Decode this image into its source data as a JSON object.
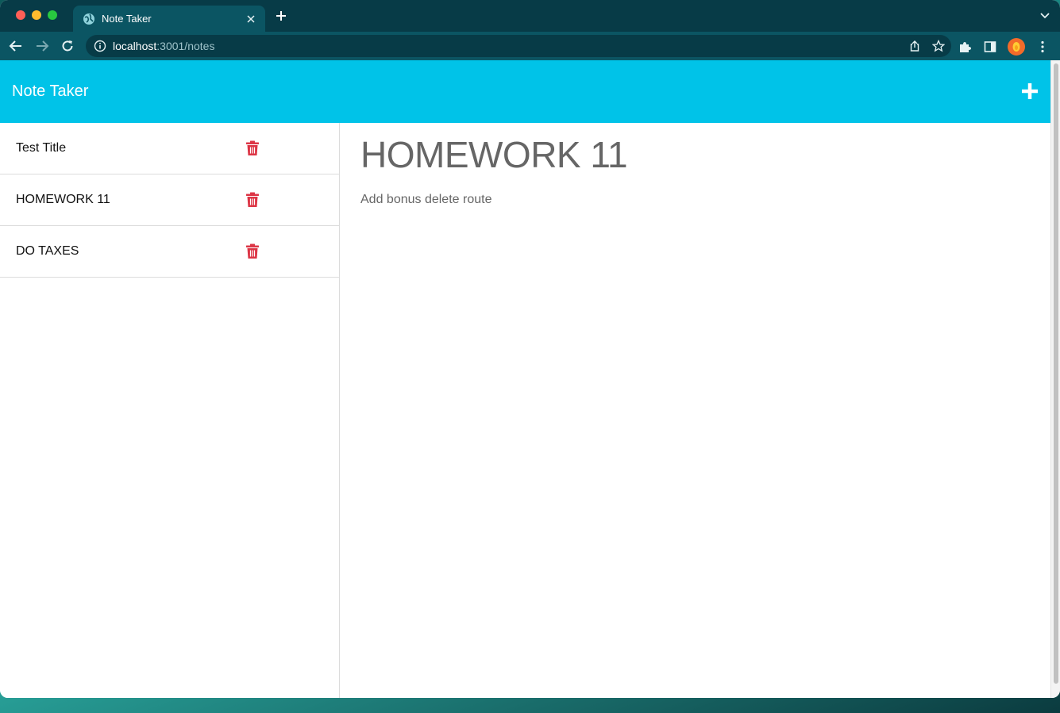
{
  "browser": {
    "tab_title": "Note Taker",
    "url_host": "localhost",
    "url_path": ":3001/notes",
    "accent": "#0b5563",
    "frame_color": "#073b47"
  },
  "app": {
    "brand": "Note Taker",
    "navbar_color": "#00c3e8",
    "delete_color": "#dc3545"
  },
  "notes": [
    {
      "title": "Test Title"
    },
    {
      "title": "HOMEWORK 11"
    },
    {
      "title": "DO TAXES"
    }
  ],
  "active_note": {
    "title": "HOMEWORK 11",
    "text": "Add bonus delete route"
  }
}
